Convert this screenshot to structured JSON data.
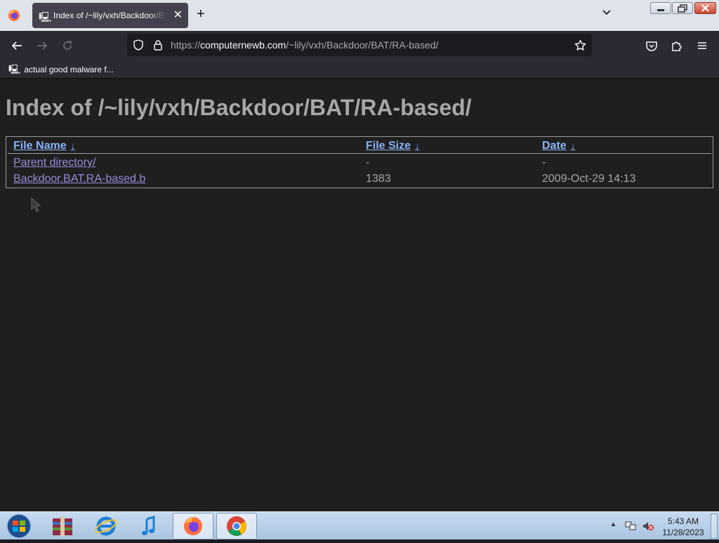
{
  "browser": {
    "tab_title": "Index of /~lily/vxh/Backdoor/BAT/RA-based/",
    "tab_close": "✕",
    "new_tab": "+",
    "url_scheme": "https://",
    "url_host": "computernewb.com",
    "url_path": "/~lily/vxh/Backdoor/BAT/RA-based/",
    "bookmark_label": "actual good malware f..."
  },
  "page": {
    "heading": "Index of /~lily/vxh/Backdoor/BAT/RA-based/",
    "columns": {
      "name": "File Name",
      "size": "File Size",
      "date": "Date",
      "sort_arrow": "↓"
    },
    "rows": [
      {
        "name": "Parent directory/",
        "size": "-",
        "date": "-"
      },
      {
        "name": "Backdoor.BAT.RA-based.b",
        "size": "1383",
        "date": "2009-Oct-29 14:13"
      }
    ]
  },
  "taskbar": {
    "apps": [
      "winrar-icon",
      "internet-explorer-icon",
      "itunes-icon",
      "firefox-icon",
      "chrome-icon"
    ],
    "time": "5:43 AM",
    "date": "11/28/2023"
  },
  "colors": {
    "link": "#9b8ad8",
    "header_link": "#8ab4f8",
    "page_bg": "#1f1f1f",
    "text": "#a7a7a7"
  }
}
